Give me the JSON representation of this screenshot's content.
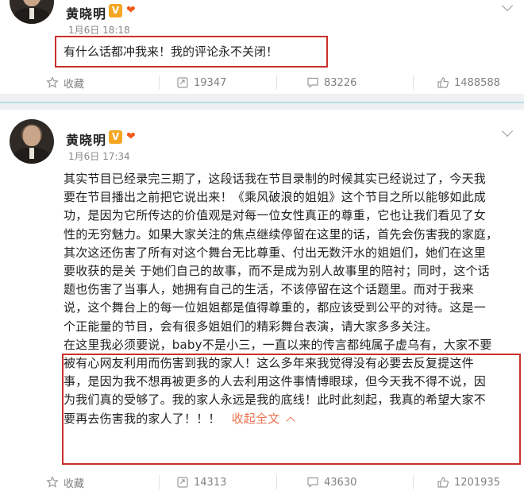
{
  "posts": [
    {
      "author": "黄晓明",
      "verified_badge": "V",
      "time": "1月6日 18:18",
      "text": "有什么话都冲我来！我的评论永不关闭！",
      "actions": {
        "favorite_label": "收藏",
        "repost_count": "19347",
        "comment_count": "83226",
        "like_count": "1488588"
      }
    },
    {
      "author": "黄晓明",
      "verified_badge": "V",
      "time": "1月6日 17:34",
      "text_lines": [
        "其实节目已经录完三期了，这段话我在节目录制的时候其实已经说过了，今天我",
        "要在节目播出之前把它说出来！《乘风破浪的姐姐》这个节目之所以能够如此成",
        "功，是因为它所传达的价值观是对每一位女性真正的尊重，它也让我们看见了女",
        "性的无穷魅力。如果大家关注的焦点继续停留在这里的话，首先会伤害我的家庭，",
        "其次这还伤害了所有对这个舞台无比尊重、付出无数汗水的姐姐们，她们在这里",
        "要收获的是关 于她们自己的故事，而不是成为别人故事里的陪衬；同时，这个话",
        "题也伤害了当事人，她拥有自己的生活，不该停留在这个话题里。而对于我来",
        "说，这个舞台上的每一位姐姐都是值得尊重的，都应该受到公平的对待。这是一",
        "个正能量的节目，会有很多姐姐们的精彩舞台表演，请大家多多关注。",
        "在这里我必须要说，baby不是小三，一直以来的传言都纯属子虚乌有，大家不要",
        "被有心网友利用而伤害到我的家人！这么多年来我觉得没有必要去反复提这件",
        "事，是因为我不想再被更多的人去利用这件事情博眼球，但今天我不得不说，因",
        "为我们真的受够了。我的家人永远是我的底线！此时此刻起，我真的希望大家不",
        "要再去伤害我的家人了！！！"
      ],
      "collapse_label": "收起全文",
      "actions": {
        "favorite_label": "收藏",
        "repost_count": "14313",
        "comment_count": "43630",
        "like_count": "1201935"
      }
    }
  ],
  "colors": {
    "highlight_box": "#c9302c",
    "link": "#eb7350",
    "separator": "#b8dde4"
  },
  "icons": [
    "favorite-star-icon",
    "repost-icon",
    "comment-icon",
    "like-thumb-icon",
    "fan-badge-icon",
    "verified-v-icon",
    "more-chevron-icon",
    "collapse-up-icon"
  ]
}
